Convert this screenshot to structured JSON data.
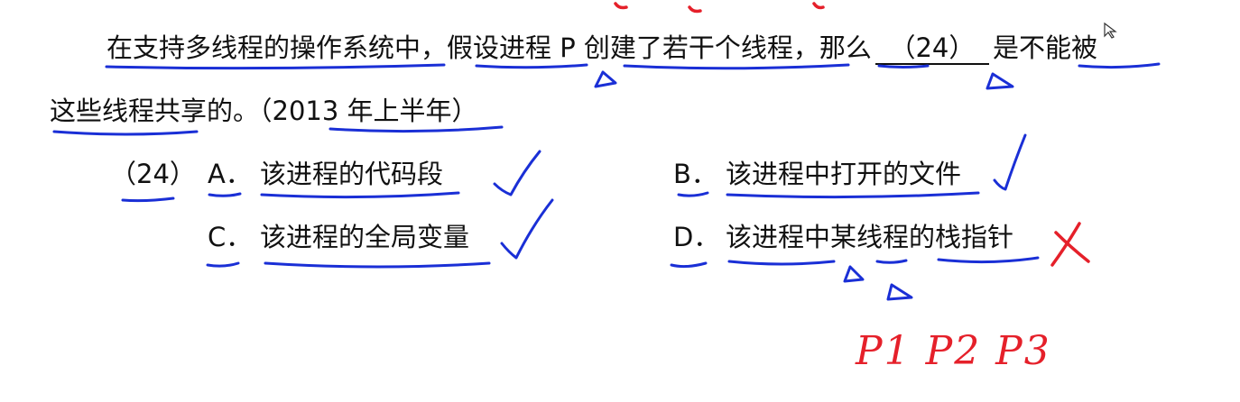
{
  "question": {
    "line1_a": "在支持多线程的操作系统中，假设进程 P 创建了若干个线程，那么",
    "blank_label": "（24）",
    "line1_b": "是不能被",
    "line2": "这些线程共享的。（2013 年上半年）"
  },
  "options": {
    "number": "（24）",
    "items": [
      {
        "letter": "A．",
        "text": "该进程的代码段"
      },
      {
        "letter": "B．",
        "text": "该进程中打开的文件"
      },
      {
        "letter": "C．",
        "text": "该进程的全局变量"
      },
      {
        "letter": "D．",
        "text": "该进程中某线程的栈指针"
      }
    ]
  },
  "annotations": {
    "handwritten_text": "P1 P2 P3",
    "pen_blue": "#1a2fd6",
    "pen_red": "#e5202a"
  }
}
